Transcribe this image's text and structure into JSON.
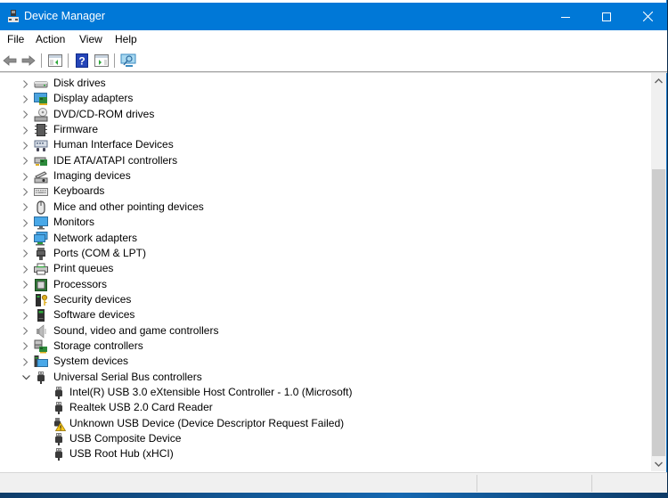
{
  "window": {
    "title": "Device Manager",
    "controls": {
      "minimize": "minimize",
      "maximize": "maximize",
      "close": "close"
    }
  },
  "menu": [
    "File",
    "Action",
    "View",
    "Help"
  ],
  "toolbar": [
    {
      "name": "back-button",
      "icon": "arrow-left-icon"
    },
    {
      "name": "forward-button",
      "icon": "arrow-right-icon"
    },
    {
      "name": "show-hide-console-tree-button",
      "icon": "console-tree-icon"
    },
    {
      "name": "help-button",
      "icon": "help-icon"
    },
    {
      "name": "show-action-pane-button",
      "icon": "action-pane-icon"
    },
    {
      "name": "scan-hardware-button",
      "icon": "monitor-scan-icon"
    }
  ],
  "tree": {
    "categories": [
      {
        "label": "Disk drives",
        "icon": "disk-drive-icon",
        "expanded": false
      },
      {
        "label": "Display adapters",
        "icon": "display-adapter-icon",
        "expanded": false
      },
      {
        "label": "DVD/CD-ROM drives",
        "icon": "dvd-drive-icon",
        "expanded": false
      },
      {
        "label": "Firmware",
        "icon": "firmware-icon",
        "expanded": false
      },
      {
        "label": "Human Interface Devices",
        "icon": "hid-icon",
        "expanded": false
      },
      {
        "label": "IDE ATA/ATAPI controllers",
        "icon": "ide-controller-icon",
        "expanded": false
      },
      {
        "label": "Imaging devices",
        "icon": "imaging-device-icon",
        "expanded": false
      },
      {
        "label": "Keyboards",
        "icon": "keyboard-icon",
        "expanded": false
      },
      {
        "label": "Mice and other pointing devices",
        "icon": "mouse-icon",
        "expanded": false
      },
      {
        "label": "Monitors",
        "icon": "monitor-icon",
        "expanded": false
      },
      {
        "label": "Network adapters",
        "icon": "network-adapter-icon",
        "expanded": false
      },
      {
        "label": "Ports (COM & LPT)",
        "icon": "port-icon",
        "expanded": false
      },
      {
        "label": "Print queues",
        "icon": "printer-icon",
        "expanded": false
      },
      {
        "label": "Processors",
        "icon": "processor-icon",
        "expanded": false
      },
      {
        "label": "Security devices",
        "icon": "security-device-icon",
        "expanded": false
      },
      {
        "label": "Software devices",
        "icon": "software-device-icon",
        "expanded": false
      },
      {
        "label": "Sound, video and game controllers",
        "icon": "speaker-icon",
        "expanded": false
      },
      {
        "label": "Storage controllers",
        "icon": "storage-controller-icon",
        "expanded": false
      },
      {
        "label": "System devices",
        "icon": "system-device-icon",
        "expanded": false
      },
      {
        "label": "Universal Serial Bus controllers",
        "icon": "usb-icon",
        "expanded": true,
        "children": [
          {
            "label": "Intel(R) USB 3.0 eXtensible Host Controller - 1.0 (Microsoft)",
            "icon": "usb-icon",
            "warning": false
          },
          {
            "label": "Realtek USB 2.0 Card Reader",
            "icon": "usb-icon",
            "warning": false
          },
          {
            "label": "Unknown USB Device (Device Descriptor Request Failed)",
            "icon": "usb-warning-icon",
            "warning": true
          },
          {
            "label": "USB Composite Device",
            "icon": "usb-icon",
            "warning": false
          },
          {
            "label": "USB Root Hub (xHCI)",
            "icon": "usb-icon",
            "warning": false
          }
        ]
      }
    ]
  },
  "scrollbar": {
    "position_fraction": 0.2,
    "visible_fraction": 0.78
  },
  "colors": {
    "titlebar": "#0078d7",
    "warning": "#f5c518"
  }
}
